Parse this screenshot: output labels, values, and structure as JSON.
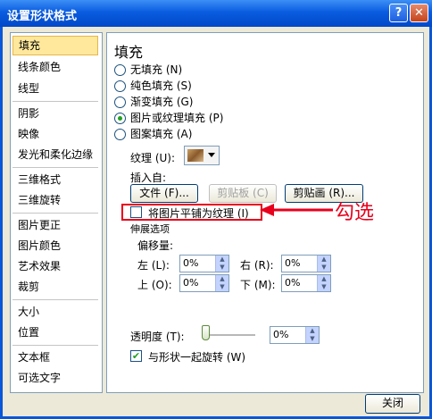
{
  "window": {
    "title": "设置形状格式",
    "help_label": "?",
    "close_label": "✕"
  },
  "sidebar": {
    "items": [
      {
        "label": "填充"
      },
      {
        "label": "线条颜色"
      },
      {
        "label": "线型"
      },
      {
        "label": "阴影"
      },
      {
        "label": "映像"
      },
      {
        "label": "发光和柔化边缘"
      },
      {
        "label": "三维格式"
      },
      {
        "label": "三维旋转"
      },
      {
        "label": "图片更正"
      },
      {
        "label": "图片颜色"
      },
      {
        "label": "艺术效果"
      },
      {
        "label": "裁剪"
      },
      {
        "label": "大小"
      },
      {
        "label": "位置"
      },
      {
        "label": "文本框"
      },
      {
        "label": "可选文字"
      }
    ],
    "selected": "填充"
  },
  "panel": {
    "title": "填充",
    "fill_options": [
      {
        "label": "无填充 (N)"
      },
      {
        "label": "纯色填充 (S)"
      },
      {
        "label": "渐变填充 (G)"
      },
      {
        "label": "图片或纹理填充 (P)"
      },
      {
        "label": "图案填充 (A)"
      }
    ],
    "selected_fill": "图片或纹理填充 (P)",
    "texture_label": "纹理 (U):",
    "insert_from_label": "插入自:",
    "file_button": "文件 (F)...",
    "clipboard_button": "剪贴板 (C)",
    "clipart_button": "剪贴画 (R)...",
    "tile_checkbox": "将图片平铺为纹理 (I)",
    "tile_checked": false,
    "stretch_label": "伸展选项",
    "offset_label": "偏移量:",
    "left_label": "左 (L):",
    "left_value": "0%",
    "right_label": "右 (R):",
    "right_value": "0%",
    "top_label": "上 (O):",
    "top_value": "0%",
    "bottom_label": "下 (M):",
    "bottom_value": "0%",
    "transparency_label": "透明度 (T):",
    "transparency_value": "0%",
    "rotate_checkbox": "与形状一起旋转 (W)",
    "rotate_checked": true
  },
  "annotation": {
    "text": "勾选"
  },
  "footer": {
    "close_button": "关闭"
  }
}
